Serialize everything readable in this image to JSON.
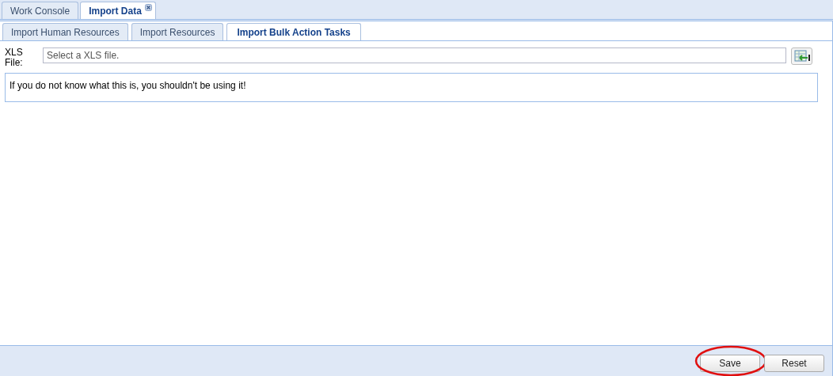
{
  "main_tabs": [
    {
      "label": "Work Console",
      "selected": false,
      "closable": false
    },
    {
      "label": "Import Data",
      "selected": true,
      "closable": true
    }
  ],
  "sub_tabs": [
    {
      "label": "Import Human Resources",
      "selected": false
    },
    {
      "label": "Import Resources",
      "selected": false
    },
    {
      "label": "Import Bulk Action Tasks",
      "selected": true
    }
  ],
  "file_field": {
    "label": "XLS File:",
    "placeholder": "Select a XLS file."
  },
  "note": "If you do not know what this is, you shouldn't be using it!",
  "buttons": [
    {
      "label": "Save",
      "highlighted": true
    },
    {
      "label": "Reset",
      "highlighted": false
    }
  ]
}
